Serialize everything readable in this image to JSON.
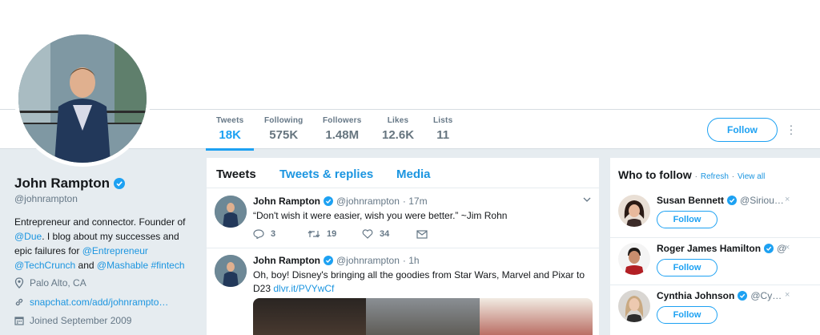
{
  "profile": {
    "name": "John Rampton",
    "handle": "@johnrampton",
    "bio_parts": {
      "p1": "Entrepreneur and connector. Founder of ",
      "due": "@Due",
      "p2": ". I blog about my successes and epic failures for ",
      "entrepreneur": "@Entrepreneur",
      "techcrunch": "@TechCrunch",
      "p3": " and ",
      "mashable": "@Mashable",
      "fintech": "#fintech"
    },
    "location": "Palo Alto, CA",
    "website": "snapchat.com/add/johnrampto…",
    "joined": "Joined September 2009"
  },
  "stats": [
    {
      "label": "Tweets",
      "value": "18K"
    },
    {
      "label": "Following",
      "value": "575K"
    },
    {
      "label": "Followers",
      "value": "1.48M"
    },
    {
      "label": "Likes",
      "value": "12.6K"
    },
    {
      "label": "Lists",
      "value": "11"
    }
  ],
  "follow_button": "Follow",
  "tabs": [
    "Tweets",
    "Tweets & replies",
    "Media"
  ],
  "tweets": [
    {
      "name": "John Rampton",
      "handle": "@johnrampton",
      "time": "· 17m",
      "text": "“Don't wish it were easier, wish you were better.” ~Jim Rohn",
      "replies": "3",
      "retweets": "19",
      "likes": "34"
    },
    {
      "name": "John Rampton",
      "handle": "@johnrampton",
      "time": "· 1h",
      "text": "Oh, boy! Disney's bringing all the goodies from Star Wars, Marvel and Pixar to D23 ",
      "link": "dlvr.it/PVYwCf"
    }
  ],
  "who_to_follow": {
    "title": "Who to follow",
    "refresh": "Refresh",
    "view_all": "View all",
    "suggestions": [
      {
        "name": "Susan Bennett",
        "handle": "@Siriou…",
        "button": "Follow"
      },
      {
        "name": "Roger James Hamilton",
        "handle": "@",
        "button": "Follow"
      },
      {
        "name": "Cynthia Johnson",
        "handle": "@Cy…",
        "button": "Follow"
      }
    ]
  },
  "colors": {
    "accent": "#1da1f2",
    "link": "#1b95e0",
    "background": "#e6ecf0"
  }
}
